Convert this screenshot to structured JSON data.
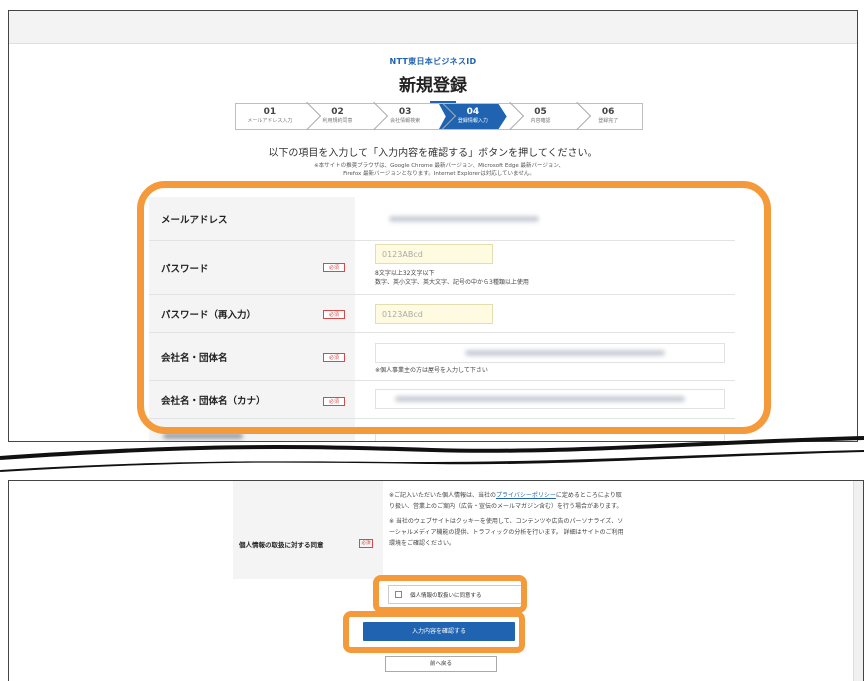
{
  "header": {
    "brand": "NTT東日本ビジネスID",
    "title": "新規登録"
  },
  "steps": [
    {
      "num": "01",
      "label": "メールアドレス入力"
    },
    {
      "num": "02",
      "label": "利用規約同意"
    },
    {
      "num": "03",
      "label": "会社情報検索"
    },
    {
      "num": "04",
      "label": "登録情報入力",
      "active": true
    },
    {
      "num": "05",
      "label": "内容確認"
    },
    {
      "num": "06",
      "label": "登録完了"
    }
  ],
  "instruction": "以下の項目を入力して「入力内容を確認する」ボタンを押してください。",
  "browser_note": {
    "line1": "※本サイトの推奨ブラウザは、Google Chrome 最新バージョン、Microsoft Edge 最新バージョン、",
    "line2": "Firefox 最新バージョンとなります。Internet Explorerは対応していません。"
  },
  "form": {
    "required_badge": "必須",
    "email": {
      "label": "メールアドレス"
    },
    "password": {
      "label": "パスワード",
      "placeholder": "0123ABcd",
      "hint1": "8文字以上32文字以下",
      "hint2": "数字、英小文字、英大文字、記号の中から3種類以上使用"
    },
    "password_confirm": {
      "label": "パスワード（再入力）",
      "placeholder": "0123ABcd"
    },
    "company": {
      "label": "会社名・団体名",
      "hint": "※個人事業主の方は屋号を入力して下さい"
    },
    "company_kana": {
      "label": "会社名・団体名（カナ）"
    }
  },
  "consent": {
    "label": "個人情報の取扱に対する同意",
    "required_badge": "必須",
    "text1_before": "※ご記入いただいた個人情報は、当社の",
    "text1_link": "プライバシーポリシー",
    "text1_after": "に定めるところにより取り扱い、営業上のご案内（広告・宣伝のメールマガジン含む）を行う場合があります。",
    "text2": "※ 当社のウェブサイトはクッキーを使用して、コンテンツや広告のパーソナライズ、ソーシャルメディア機能の提供、トラフィックの分析を行います。 詳細はサイトのご利用環境をご確認ください。",
    "agree_label": "個人情報の取扱いに同意する"
  },
  "buttons": {
    "confirm": "入力内容を確認する",
    "back": "前へ戻る"
  },
  "colors": {
    "accent": "#1f63b1",
    "annotation": "#f59a3a",
    "required": "#d84a4a"
  }
}
